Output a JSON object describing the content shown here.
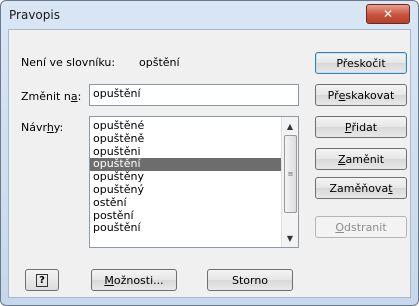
{
  "window": {
    "title": "Pravopis",
    "close_glyph": "✕"
  },
  "not_in_dictionary": {
    "label_pre": "Není ve slovníku:",
    "word": "opštění"
  },
  "change_to": {
    "label_pre": "Změnit n",
    "label_key": "a",
    "label_post": ":",
    "value": "opuštění"
  },
  "suggestions": {
    "label_pre": "Návr",
    "label_key": "h",
    "label_post": "y:",
    "items": [
      "opuštěné",
      "opuštěně",
      "opuštěni",
      "opuštění",
      "opuštěny",
      "opuštěný",
      "ostění",
      "postění",
      "pouštění"
    ],
    "selected_index": 3
  },
  "scrollbar": {
    "up_glyph": "▲",
    "down_glyph": "▼",
    "grip_glyph": "≡"
  },
  "buttons": {
    "skip": {
      "pre": "Přeskočit",
      "key": "",
      "post": ""
    },
    "skip_all": {
      "pre": "Př",
      "key": "e",
      "post": "skakovat"
    },
    "add": {
      "pre": "",
      "key": "P",
      "post": "řidat"
    },
    "change": {
      "pre": "",
      "key": "Z",
      "post": "aměnit"
    },
    "change_all": {
      "pre": "Zaměňova",
      "key": "t",
      "post": ""
    },
    "delete": {
      "pre": "",
      "key": "O",
      "post": "dstranit"
    },
    "options": {
      "pre": "",
      "key": "M",
      "post": "ožnosti..."
    },
    "cancel": {
      "pre": "Storno",
      "key": "",
      "post": ""
    },
    "help_glyph": "?"
  }
}
